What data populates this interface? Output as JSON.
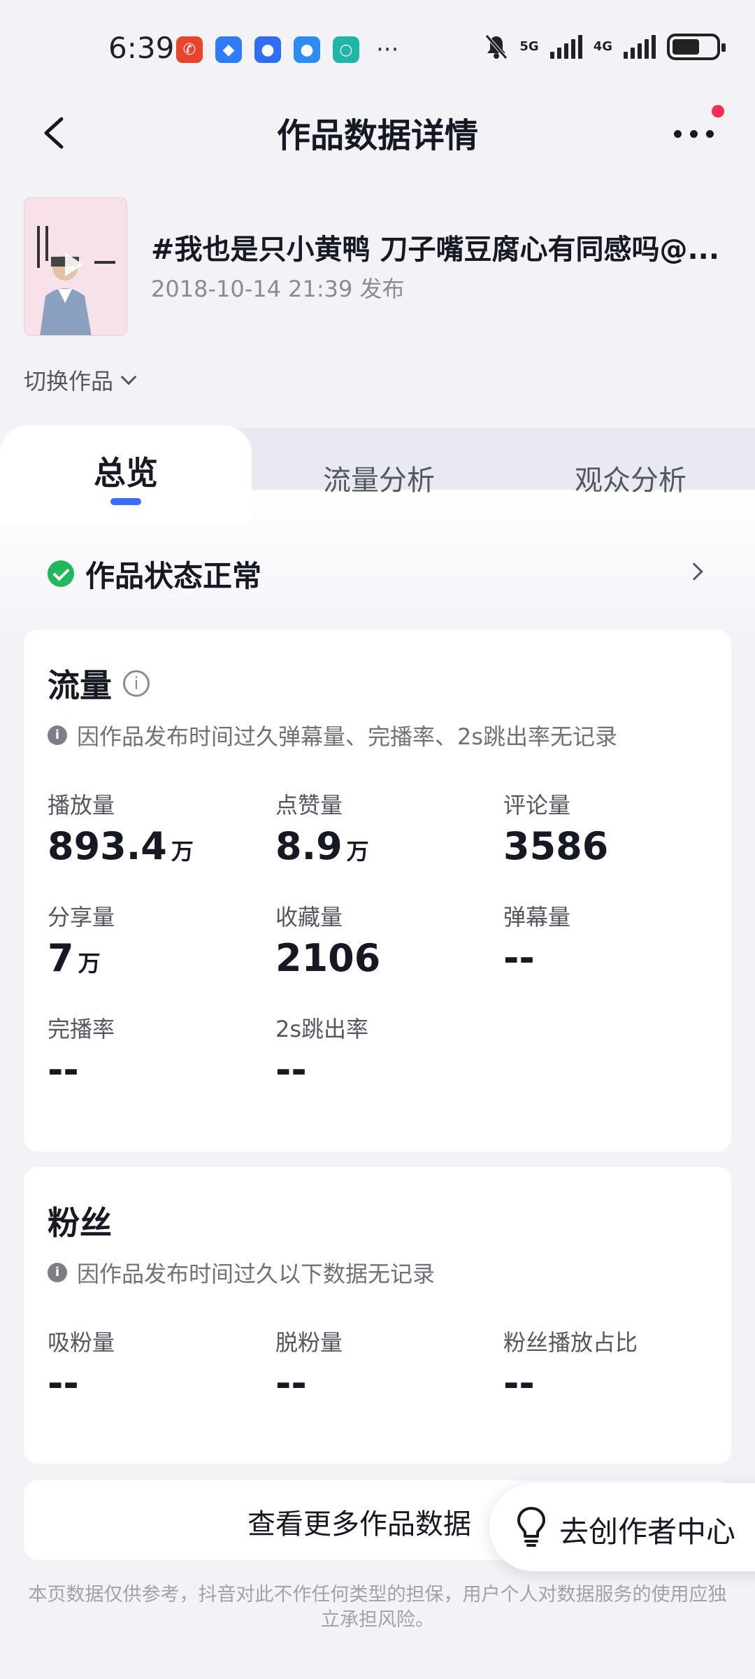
{
  "status_bar": {
    "time": "6:39",
    "network_1": "5G",
    "network_2": "4G"
  },
  "header": {
    "title": "作品数据详情"
  },
  "video": {
    "title": "#我也是只小黄鸭 刀子嘴豆腐心有同感吗@...",
    "date": "2018-10-14 21:39 发布",
    "switch_label": "切换作品"
  },
  "tabs": [
    {
      "label": "总览"
    },
    {
      "label": "流量分析"
    },
    {
      "label": "观众分析"
    }
  ],
  "status": {
    "text": "作品状态正常"
  },
  "traffic": {
    "title": "流量",
    "info_icon": "info-outline-icon",
    "note": "因作品发布时间过久弹幕量、完播率、2s跳出率无记录",
    "metrics": [
      {
        "label": "播放量",
        "value": "893.4",
        "unit": "万"
      },
      {
        "label": "点赞量",
        "value": "8.9",
        "unit": "万"
      },
      {
        "label": "评论量",
        "value": "3586",
        "unit": ""
      },
      {
        "label": "分享量",
        "value": "7",
        "unit": "万"
      },
      {
        "label": "收藏量",
        "value": "2106",
        "unit": ""
      },
      {
        "label": "弹幕量",
        "value": "--",
        "unit": ""
      },
      {
        "label": "完播率",
        "value": "--",
        "unit": ""
      },
      {
        "label": "2s跳出率",
        "value": "--",
        "unit": ""
      }
    ]
  },
  "fans": {
    "title": "粉丝",
    "note": "因作品发布时间过久以下数据无记录",
    "metrics": [
      {
        "label": "吸粉量",
        "value": "--"
      },
      {
        "label": "脱粉量",
        "value": "--"
      },
      {
        "label": "粉丝播放占比",
        "value": "--"
      }
    ]
  },
  "bottom": {
    "more_data": "查看更多作品数据",
    "creator_center": "去创作者中心",
    "disclaimer": "本页数据仅供参考，抖音对此不作任何类型的担保，用户个人对数据服务的使用应独立承担风险。"
  },
  "colors": {
    "accent": "#3c6cf0",
    "success": "#22b85a",
    "notification": "#fe2c55"
  }
}
